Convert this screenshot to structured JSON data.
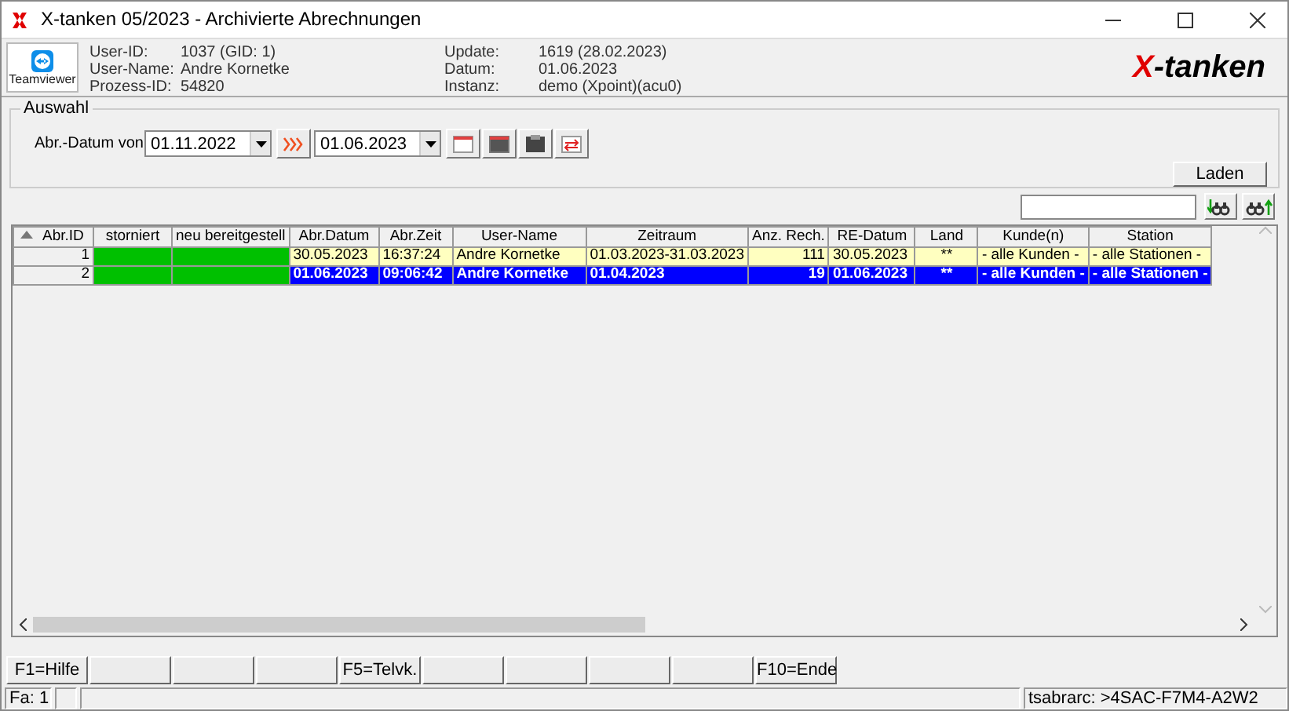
{
  "window": {
    "title": "X-tanken 05/2023 - Archivierte Abrechnungen"
  },
  "toolbar": {
    "teamviewer_label": "Teamviewer"
  },
  "info": [
    {
      "label": "User-ID:",
      "value": "1037 (GID: 1)"
    },
    {
      "label": "User-Name:",
      "value": "Andre Kornetke"
    },
    {
      "label": "Prozess-ID:",
      "value": "54820"
    },
    {
      "label": "Update:",
      "value": "1619 (28.02.2023)"
    },
    {
      "label": "Datum:",
      "value": "01.06.2023"
    },
    {
      "label": "Instanz:",
      "value": "demo (Xpoint)(acu0)"
    }
  ],
  "logo": {
    "mark": "X",
    "text": "-tanken"
  },
  "auswahl": {
    "title": "Auswahl",
    "label": "Abr.-Datum von",
    "from": "01.11.2022",
    "to": "01.06.2023",
    "load_button": "Laden"
  },
  "table": {
    "columns": [
      "Abr.ID",
      "storniert",
      "neu bereitgestell",
      "Abr.Datum",
      "Abr.Zeit",
      "User-Name",
      "Zeitraum",
      "Anz. Rech.",
      "RE-Datum",
      "Land",
      "Kunde(n)",
      "Station"
    ],
    "rows": [
      {
        "selected": false,
        "cells": [
          "1",
          {
            "color": "#00c000"
          },
          {
            "color": "#00c000"
          },
          "30.05.2023",
          "16:37:24",
          "Andre Kornetke",
          "01.03.2023-31.03.2023",
          "111",
          "30.05.2023",
          "**",
          "- alle Kunden -",
          "- alle Stationen -"
        ]
      },
      {
        "selected": true,
        "cells": [
          "2",
          {
            "color": "#00c000"
          },
          {
            "color": "#00c000"
          },
          "01.06.2023",
          "09:06:42",
          "Andre Kornetke",
          "01.04.2023",
          "19",
          "01.06.2023",
          "**",
          "- alle Kunden -",
          "- alle Stationen -"
        ]
      }
    ]
  },
  "function_keys": [
    {
      "kind": "key",
      "label": "F1=Hilfe"
    },
    {
      "kind": "blank"
    },
    {
      "kind": "blank"
    },
    {
      "kind": "blank"
    },
    {
      "kind": "key",
      "label": "F5=Telvk."
    },
    {
      "kind": "blank"
    },
    {
      "kind": "blank"
    },
    {
      "kind": "blank"
    },
    {
      "kind": "blank"
    },
    {
      "kind": "key",
      "label": "F10=Ende"
    }
  ],
  "status_bar": {
    "left": "Fa: 1",
    "right": "tsabrarc: >4SAC-F7M4-A2W2"
  }
}
